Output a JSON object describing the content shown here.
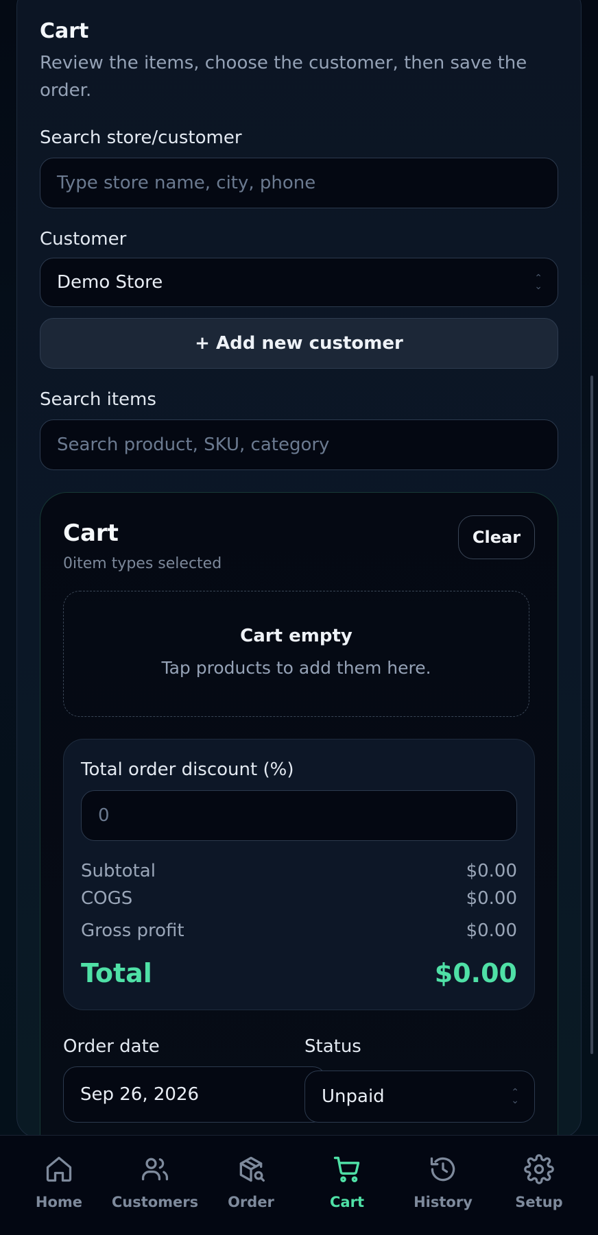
{
  "header": {
    "title": "Cart",
    "subtitle": "Review the items, choose the customer, then save the order."
  },
  "search_customer": {
    "label": "Search store/customer",
    "placeholder": "Type store name, city, phone",
    "value": ""
  },
  "customer": {
    "label": "Customer",
    "selected": "Demo Store",
    "add_button": "+ Add new customer"
  },
  "search_items": {
    "label": "Search items",
    "placeholder": "Search product, SKU, category",
    "value": ""
  },
  "cart": {
    "title": "Cart",
    "count_text": "0item types selected",
    "clear_label": "Clear",
    "empty_title": "Cart empty",
    "empty_subtitle": "Tap products to add them here."
  },
  "summary": {
    "discount_label": "Total order discount (%)",
    "discount_placeholder": "0",
    "subtotal_label": "Subtotal",
    "subtotal_value": "$0.00",
    "cogs_label": "COGS",
    "cogs_value": "$0.00",
    "gross_profit_label": "Gross profit",
    "gross_profit_value": "$0.00",
    "total_label": "Total",
    "total_value": "$0.00"
  },
  "order": {
    "date_label": "Order date",
    "date_value": "Sep 26, 2026",
    "status_label": "Status",
    "status_value": "Unpaid"
  },
  "nav": {
    "items": [
      {
        "label": "Home",
        "icon": "home-icon"
      },
      {
        "label": "Customers",
        "icon": "users-icon"
      },
      {
        "label": "Order",
        "icon": "package-search-icon"
      },
      {
        "label": "Cart",
        "icon": "cart-icon",
        "active": true
      },
      {
        "label": "History",
        "icon": "history-icon"
      },
      {
        "label": "Setup",
        "icon": "gear-icon"
      }
    ]
  },
  "colors": {
    "accent": "#4fe0a6",
    "background": "#030712",
    "card": "#0c1524"
  }
}
